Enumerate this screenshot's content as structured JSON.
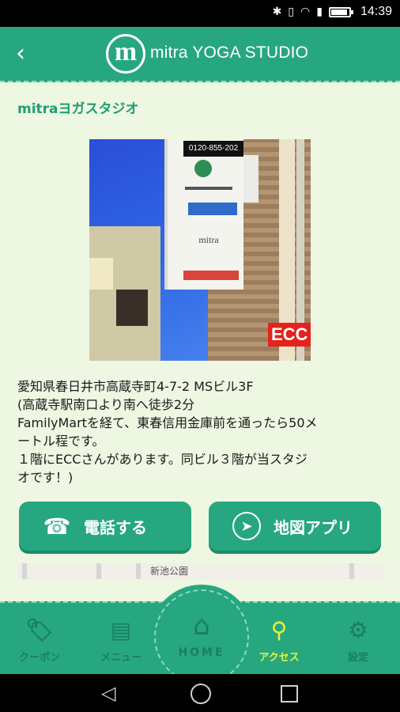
{
  "status_bar": {
    "time": "14:39",
    "icons": [
      "bluetooth-icon",
      "vibrate-icon",
      "wifi-icon",
      "sim-icon",
      "battery-icon"
    ],
    "battery_level": 0.85
  },
  "header": {
    "back_icon": "chevron-left-icon",
    "logo_letter": "m",
    "brand": "mitra YOGA STUDIO"
  },
  "page": {
    "title": "mitraヨガスタジオ",
    "photo_sign_phone": "0120-855-202",
    "photo_sign_name": "mitra",
    "photo_ecc": "ECC",
    "description": [
      "愛知県春日井市高蔵寺町4-7-2 MSビル3F",
      "(高蔵寺駅南口より南へ徒歩2分",
      "FamilyMartを経て、東春信用金庫前を通ったら50メ",
      "ートル程です。",
      "１階にECCさんがあります。同ビル３階が当スタジ",
      "オです！)"
    ]
  },
  "actions": {
    "call_label": "電話する",
    "call_icon": "phone-icon",
    "map_label": "地図アプリ",
    "map_icon": "compass-icon"
  },
  "map": {
    "label": "新池公園"
  },
  "tabbar": {
    "coupon": "クーポン",
    "menu": "メニュー",
    "home": "HOME",
    "access": "アクセス",
    "settings": "設定"
  },
  "colors": {
    "primary": "#26a77f",
    "background": "#eef7e2",
    "title_green": "#1f9e74",
    "active_tab": "#e6f23c"
  }
}
